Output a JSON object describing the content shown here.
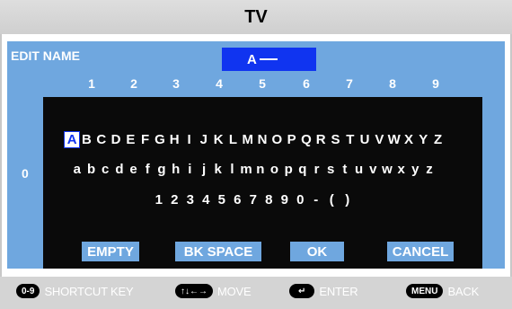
{
  "window": {
    "title": "TV"
  },
  "editor": {
    "label": "EDIT NAME",
    "current_value": "A"
  },
  "grid": {
    "column_numbers": [
      "1",
      "2",
      "3",
      "4",
      "5",
      "6",
      "7",
      "8",
      "9"
    ],
    "row_number": "0"
  },
  "keyboard": {
    "uppercase": [
      "A",
      "B",
      "C",
      "D",
      "E",
      "F",
      "G",
      "H",
      "I",
      "J",
      "K",
      "L",
      "M",
      "N",
      "O",
      "P",
      "Q",
      "R",
      "S",
      "T",
      "U",
      "V",
      "W",
      "X",
      "Y",
      "Z"
    ],
    "lowercase": [
      "a",
      "b",
      "c",
      "d",
      "e",
      "f",
      "g",
      "h",
      "i",
      "j",
      "k",
      "l",
      "m",
      "n",
      "o",
      "p",
      "q",
      "r",
      "s",
      "t",
      "u",
      "v",
      "w",
      "x",
      "y",
      "z"
    ],
    "digits": [
      "1",
      "2",
      "3",
      "4",
      "5",
      "6",
      "7",
      "8",
      "9",
      "0",
      "-",
      "(",
      ")"
    ],
    "selected_key": "A"
  },
  "actions": {
    "empty": "EMPTY",
    "backspace": "BK SPACE",
    "ok": "OK",
    "cancel": "CANCEL"
  },
  "footer": {
    "shortcut_key": "0-9",
    "shortcut_label": "SHORTCUT KEY",
    "move_key": "↑↓←→",
    "move_label": "MOVE",
    "enter_key": "↵",
    "enter_label": "ENTER",
    "menu_key": "MENU",
    "menu_label": "BACK"
  },
  "colors": {
    "panel": "#6fa7df",
    "name_field": "#1034f0",
    "keyboard_bg": "#0a0a0a",
    "title_bar": "#d6d6d6"
  }
}
